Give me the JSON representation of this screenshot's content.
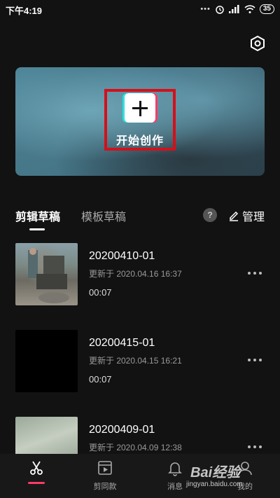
{
  "status_bar": {
    "time": "下午4:19",
    "battery": "35"
  },
  "hero": {
    "create_label": "开始创作"
  },
  "tabs": {
    "active": "剪辑草稿",
    "inactive": "模板草稿",
    "help": "?",
    "manage": "管理"
  },
  "drafts": [
    {
      "title": "20200410-01",
      "updated": "更新于 2020.04.16 16:37",
      "duration": "00:07"
    },
    {
      "title": "20200415-01",
      "updated": "更新于 2020.04.15 16:21",
      "duration": "00:07"
    },
    {
      "title": "20200409-01",
      "updated": "更新于 2020.04.09 12:38",
      "duration": ""
    }
  ],
  "bottom_nav": [
    {
      "label": "",
      "icon": "scissors-icon",
      "active": true
    },
    {
      "label": "剪同款",
      "icon": "template-video-icon",
      "active": false
    },
    {
      "label": "消息",
      "icon": "bell-icon",
      "active": false
    },
    {
      "label": "我的",
      "icon": "profile-icon",
      "active": false
    }
  ],
  "watermark": {
    "brand": "Bai经验",
    "url": "jingyan.baidu.com"
  },
  "colors": {
    "background": "#121212",
    "accent": "#ff3a67",
    "highlight": "#d4101a"
  }
}
